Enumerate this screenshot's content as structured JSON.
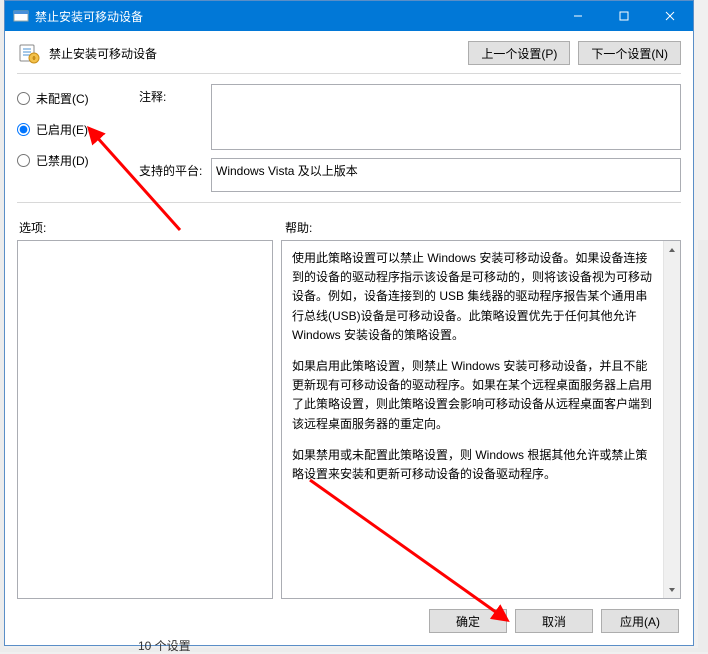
{
  "titlebar": {
    "title": "禁止安装可移动设备"
  },
  "header": {
    "policy_title": "禁止安装可移动设备",
    "prev_btn": "上一个设置(P)",
    "next_btn": "下一个设置(N)"
  },
  "radios": {
    "not_configured": "未配置(C)",
    "enabled": "已启用(E)",
    "disabled": "已禁用(D)",
    "selected": "enabled"
  },
  "fields": {
    "comment_label": "注释:",
    "comment_value": "",
    "platform_label": "支持的平台:",
    "platform_value": "Windows Vista 及以上版本"
  },
  "mid": {
    "options_label": "选项:",
    "help_label": "帮助:"
  },
  "help": {
    "p1": "使用此策略设置可以禁止 Windows 安装可移动设备。如果设备连接到的设备的驱动程序指示该设备是可移动的，则将该设备视为可移动设备。例如，设备连接到的 USB 集线器的驱动程序报告某个通用串行总线(USB)设备是可移动设备。此策略设置优先于任何其他允许 Windows 安装设备的策略设置。",
    "p2": "如果启用此策略设置，则禁止 Windows 安装可移动设备，并且不能更新现有可移动设备的驱动程序。如果在某个远程桌面服务器上启用了此策略设置，则此策略设置会影响可移动设备从远程桌面客户端到该远程桌面服务器的重定向。",
    "p3": "如果禁用或未配置此策略设置，则 Windows 根据其他允许或禁止策略设置来安装和更新可移动设备的设备驱动程序。"
  },
  "footer": {
    "ok": "确定",
    "cancel": "取消",
    "apply": "应用(A)"
  },
  "stray": "10 个设置"
}
